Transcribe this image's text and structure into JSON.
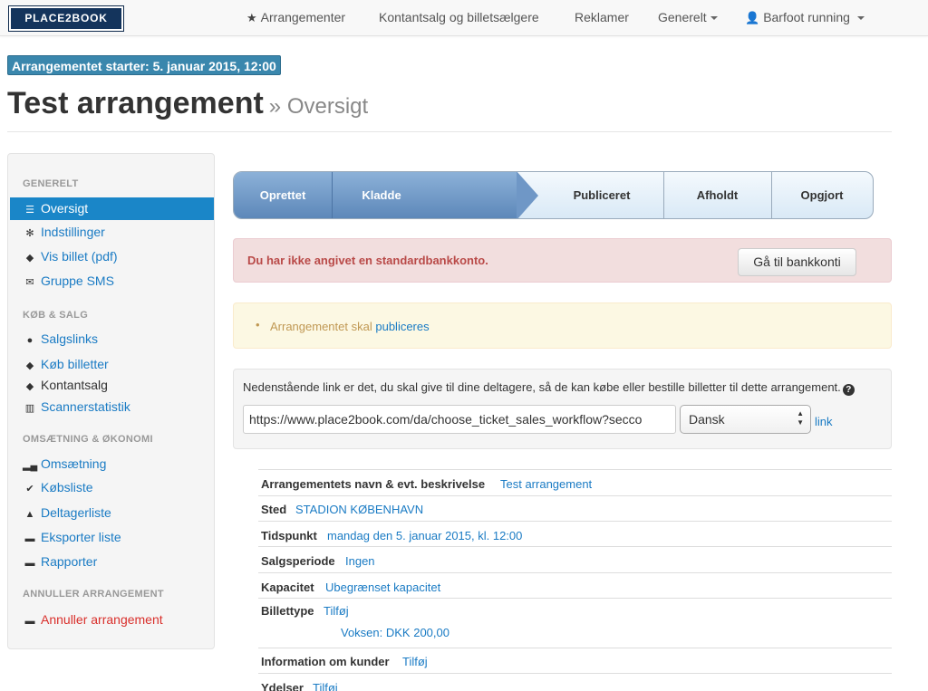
{
  "navbar": {
    "logo": "PLACE2BOOK",
    "events": "Arrangementer",
    "cash_sales": "Kontantsalg og billetsælgere",
    "ads": "Reklamer",
    "general": "Generelt",
    "user": "Barfoot running"
  },
  "badge": "Arrangementet starter: 5. januar 2015, 12:00",
  "title": {
    "main": "Test arrangement",
    "sub": "» Oversigt"
  },
  "sidebar": {
    "sections": [
      "GENERELT",
      "KØB & SALG",
      "OMSÆTNING & ØKONOMI",
      "ANNULLER ARRANGEMENT"
    ],
    "items": [
      {
        "label": "Oversigt",
        "icon": "list-icon"
      },
      {
        "label": "Indstillinger",
        "icon": "gear-icon"
      },
      {
        "label": "Vis billet (pdf)",
        "icon": "tag-icon"
      },
      {
        "label": "Gruppe SMS",
        "icon": "envelope-icon"
      },
      {
        "label": "Salgslinks",
        "icon": "globe-icon"
      },
      {
        "label": "Køb billetter",
        "icon": "tag-icon"
      },
      {
        "label": "Kontantsalg",
        "icon": "tag-icon"
      },
      {
        "label": "Scannerstatistik",
        "icon": "barcode-icon"
      },
      {
        "label": "Omsætning",
        "icon": "signal-icon"
      },
      {
        "label": "Købsliste",
        "icon": "check-icon"
      },
      {
        "label": "Deltagerliste",
        "icon": "user-icon"
      },
      {
        "label": "Eksporter liste",
        "icon": "folder-icon"
      },
      {
        "label": "Rapporter",
        "icon": "folder-icon"
      },
      {
        "label": "Annuller arrangement",
        "icon": "folder-icon"
      }
    ]
  },
  "wizard": {
    "steps": [
      "Oprettet",
      "Kladde",
      "Publiceret",
      "Afholdt",
      "Opgjort"
    ]
  },
  "alert_danger": {
    "text": "Du har ikke angivet en standardbankkonto.",
    "button": "Gå til bankkonti"
  },
  "alert_warning": {
    "text": "Arrangementet skal",
    "link": "publiceres"
  },
  "link_box": {
    "text": "Nedenstående link er det, du skal give til dine deltagere, så de kan købe eller bestille billetter til dette arrangement.",
    "url": "https://www.place2book.com/da/choose_ticket_sales_workflow?secco",
    "language": "Dansk",
    "link": "link"
  },
  "details": [
    {
      "label": "Arrangementets navn & evt. beskrivelse",
      "value": "Test arrangement"
    },
    {
      "label": "Sted",
      "value": "STADION KØBENHAVN"
    },
    {
      "label": "Tidspunkt",
      "value": "mandag den 5. januar 2015, kl. 12:00"
    },
    {
      "label": "Salgsperiode",
      "value": "Ingen"
    },
    {
      "label": "Kapacitet",
      "value": "Ubegrænset kapacitet"
    },
    {
      "label": "Billettype",
      "value": "Tilføj",
      "extra": "Voksen: DKK 200,00"
    },
    {
      "label": "Information om kunder",
      "value": "Tilføj"
    },
    {
      "label": "Ydelser",
      "value": "Tilføj"
    }
  ],
  "colors": {
    "accent": "#1a86c8",
    "badge": "#3a87ad",
    "danger": "#b94a48",
    "warning": "#c09853"
  }
}
